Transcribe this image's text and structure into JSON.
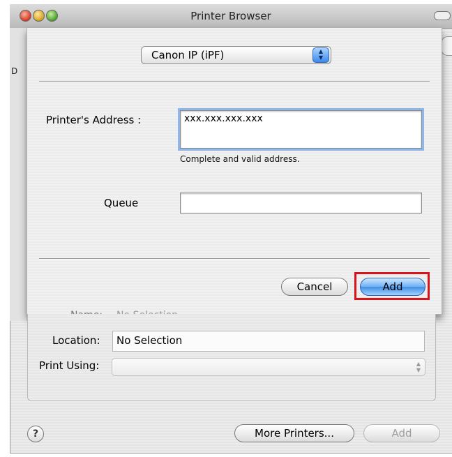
{
  "window": {
    "title": "Printer Browser"
  },
  "background": {
    "tab_fragment": "D",
    "name_label": "Name:",
    "name_value": "No Selection"
  },
  "sheet": {
    "protocol_popup": {
      "selected": "Canon IP (iPF)"
    },
    "address": {
      "label": "Printer's Address :",
      "value": "xxx.xxx.xxx.xxx",
      "hint": "Complete and valid address."
    },
    "queue": {
      "label": "Queue",
      "value": ""
    },
    "buttons": {
      "cancel": "Cancel",
      "add": "Add"
    }
  },
  "lower": {
    "location": {
      "label": "Location:",
      "value": "No Selection"
    },
    "print_using": {
      "label": "Print Using:",
      "value": ""
    }
  },
  "footer": {
    "help": "?",
    "more_printers": "More Printers...",
    "add": "Add"
  },
  "colors": {
    "highlight": "#d6141a",
    "accent_blue": "#3e8ee6"
  }
}
